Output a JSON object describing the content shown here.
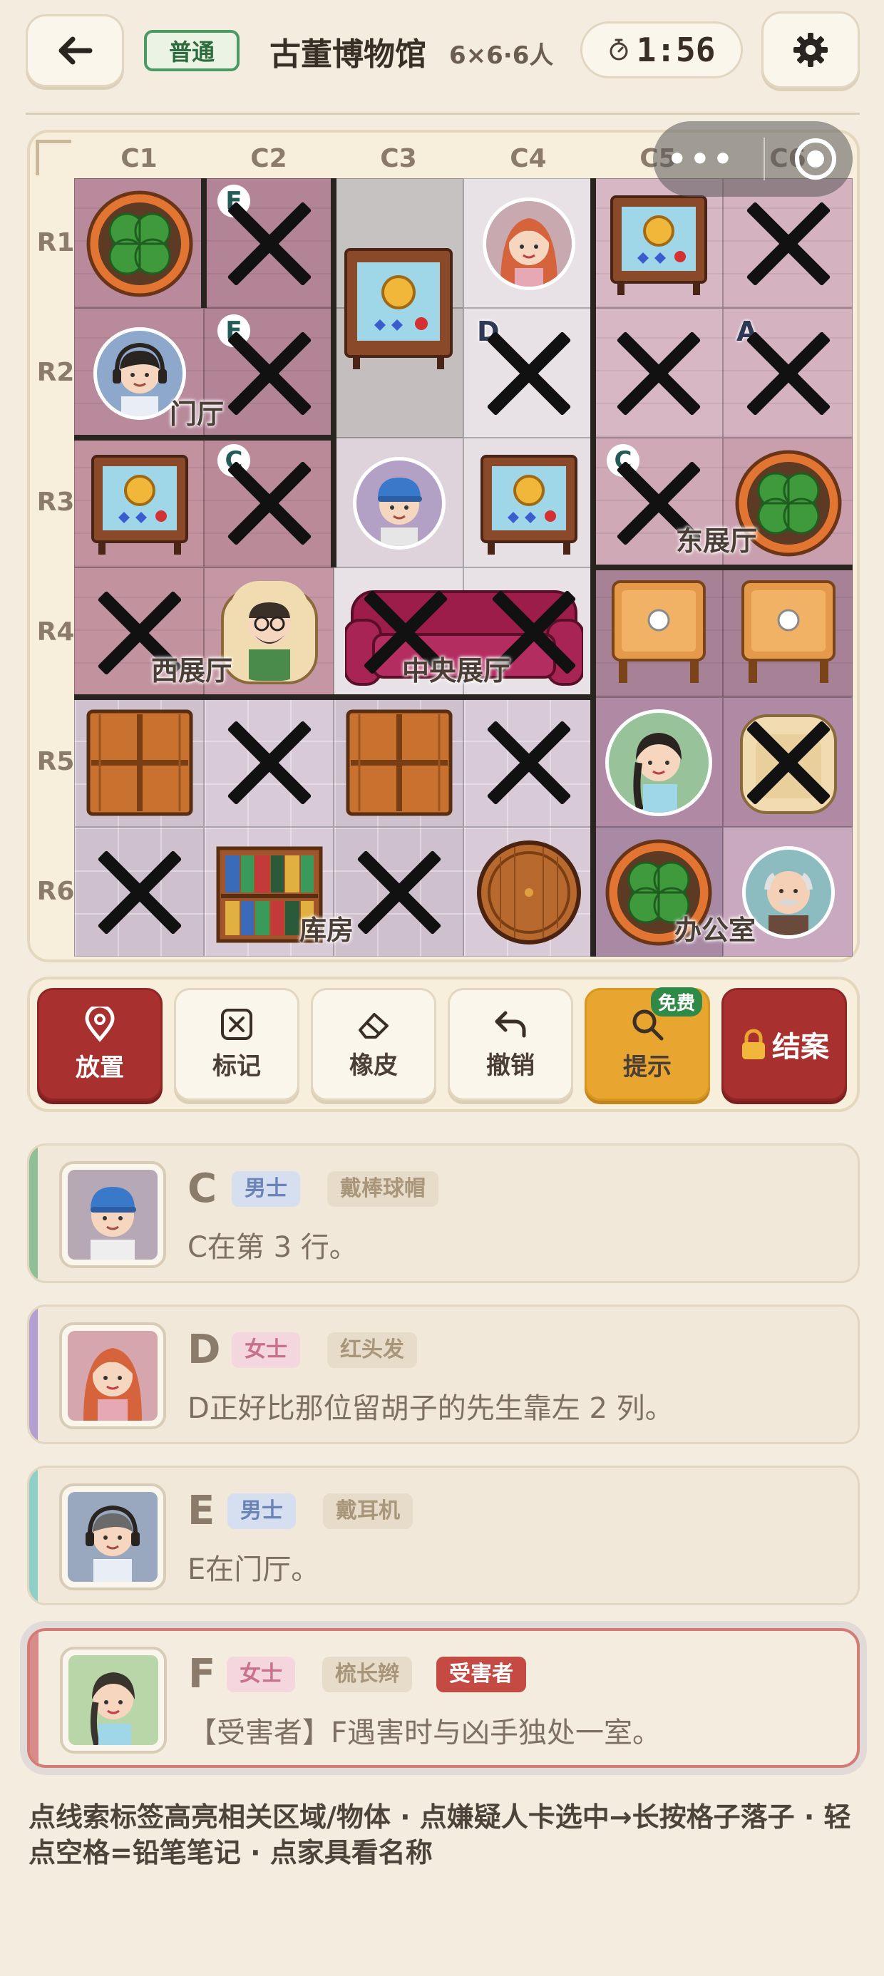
{
  "header": {
    "difficulty": "普通",
    "title": "古董博物馆",
    "subtitle": "6×6·6人",
    "timer": "1:56",
    "icons": {
      "back": "back-arrow-icon",
      "timer": "stopwatch-icon",
      "settings": "gear-icon"
    }
  },
  "board": {
    "columns": [
      "C1",
      "C2",
      "C3",
      "C4",
      "C5",
      "C6"
    ],
    "rows": [
      "R1",
      "R2",
      "R3",
      "R4",
      "R5",
      "R6"
    ],
    "rooms": {
      "lobby": "门厅",
      "east_hall": "东展厅",
      "west_hall": "西展厅",
      "center_hall": "中央展厅",
      "storage": "库房",
      "office": "办公室"
    },
    "pencil_marks": {
      "r1c2": "E",
      "r2c2": "E",
      "r2c4": "D",
      "r2c6": "A",
      "r3c2": "C",
      "r3c5": "C"
    }
  },
  "capsule": {
    "more": "•••",
    "icons": {
      "more": "more-dots-icon",
      "close": "target-close-icon"
    }
  },
  "toolbar": {
    "place": "放置",
    "mark": "标记",
    "eraser": "橡皮",
    "undo": "撤销",
    "hint": "提示",
    "hint_badge": "免费",
    "close_case": "结案"
  },
  "clues": [
    {
      "letter": "C",
      "gender": "男士",
      "attr": "戴棒球帽",
      "text": "C在第 3 行。",
      "stripe": "#8fbf97"
    },
    {
      "letter": "D",
      "gender": "女士",
      "attr": "红头发",
      "text": "D正好比那位留胡子的先生靠左 2 列。",
      "stripe": "#b49fd3"
    },
    {
      "letter": "E",
      "gender": "男士",
      "attr": "戴耳机",
      "text": "E在门厅。",
      "stripe": "#8dcfc9"
    },
    {
      "letter": "F",
      "gender": "女士",
      "attr": "梳长辫",
      "victim": "受害者",
      "text": "【受害者】F遇害时与凶手独处一室。",
      "stripe": "#d98a8a"
    }
  ],
  "footer": "点线索标签高亮相关区域/物体 · 点嫌疑人卡选中→长按格子落子 · 轻点空格=铅笔笔记 · 点家具看名称"
}
